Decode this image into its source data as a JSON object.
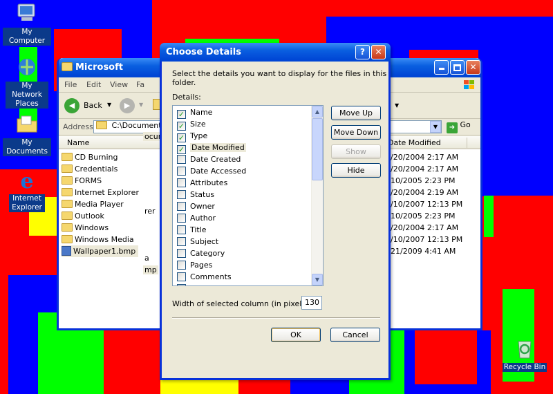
{
  "desktop_icons": [
    {
      "label": "My Computer"
    },
    {
      "label": "My Network Places"
    },
    {
      "label": "My Documents"
    },
    {
      "label": "Internet Explorer"
    },
    {
      "label": "Recycle Bin"
    }
  ],
  "explorer": {
    "title": "Microsoft",
    "menu": [
      "File",
      "Edit",
      "View",
      "Fa"
    ],
    "back_label": "Back",
    "address_label": "Address",
    "address_value": "C:\\Documents an",
    "go_label": "Go",
    "column_name": "Name",
    "column_date": "Date Modified",
    "files": [
      {
        "name": "CD Burning",
        "type": "folder"
      },
      {
        "name": "Credentials",
        "type": "folder"
      },
      {
        "name": "FORMS",
        "type": "folder"
      },
      {
        "name": "Internet Explorer",
        "type": "folder"
      },
      {
        "name": "Media Player",
        "type": "folder"
      },
      {
        "name": "Outlook",
        "type": "folder"
      },
      {
        "name": "Windows",
        "type": "folder"
      },
      {
        "name": "Windows Media",
        "type": "folder"
      },
      {
        "name": "Wallpaper1.bmp",
        "type": "file"
      }
    ],
    "partial_texts": [
      "ocume",
      "rer",
      "a",
      "mp"
    ],
    "dates": [
      "/20/2004 2:17 AM",
      "/20/2004 2:17 AM",
      "10/2005 2:23 PM",
      "/20/2004 2:19 AM",
      "/10/2007 12:13 PM",
      "10/2005 2:23 PM",
      "/20/2004 2:17 AM",
      "/10/2007 12:13 PM",
      "21/2009 4:41 AM"
    ]
  },
  "dialog": {
    "title": "Choose Details",
    "instruction": "Select the details you want to display for the files in this folder.",
    "details_label": "Details:",
    "items": [
      {
        "name": "Name",
        "checked": true
      },
      {
        "name": "Size",
        "checked": true
      },
      {
        "name": "Type",
        "checked": true
      },
      {
        "name": "Date Modified",
        "checked": true
      },
      {
        "name": "Date Created",
        "checked": false
      },
      {
        "name": "Date Accessed",
        "checked": false
      },
      {
        "name": "Attributes",
        "checked": false
      },
      {
        "name": "Status",
        "checked": false
      },
      {
        "name": "Owner",
        "checked": false
      },
      {
        "name": "Author",
        "checked": false
      },
      {
        "name": "Title",
        "checked": false
      },
      {
        "name": "Subject",
        "checked": false
      },
      {
        "name": "Category",
        "checked": false
      },
      {
        "name": "Pages",
        "checked": false
      },
      {
        "name": "Comments",
        "checked": false
      }
    ],
    "move_up": "Move Up",
    "move_down": "Move Down",
    "show": "Show",
    "hide": "Hide",
    "width_label": "Width of selected column (in pixels):",
    "width_value": "130",
    "ok": "OK",
    "cancel": "Cancel",
    "help_glyph": "?",
    "close_glyph": "✕"
  }
}
